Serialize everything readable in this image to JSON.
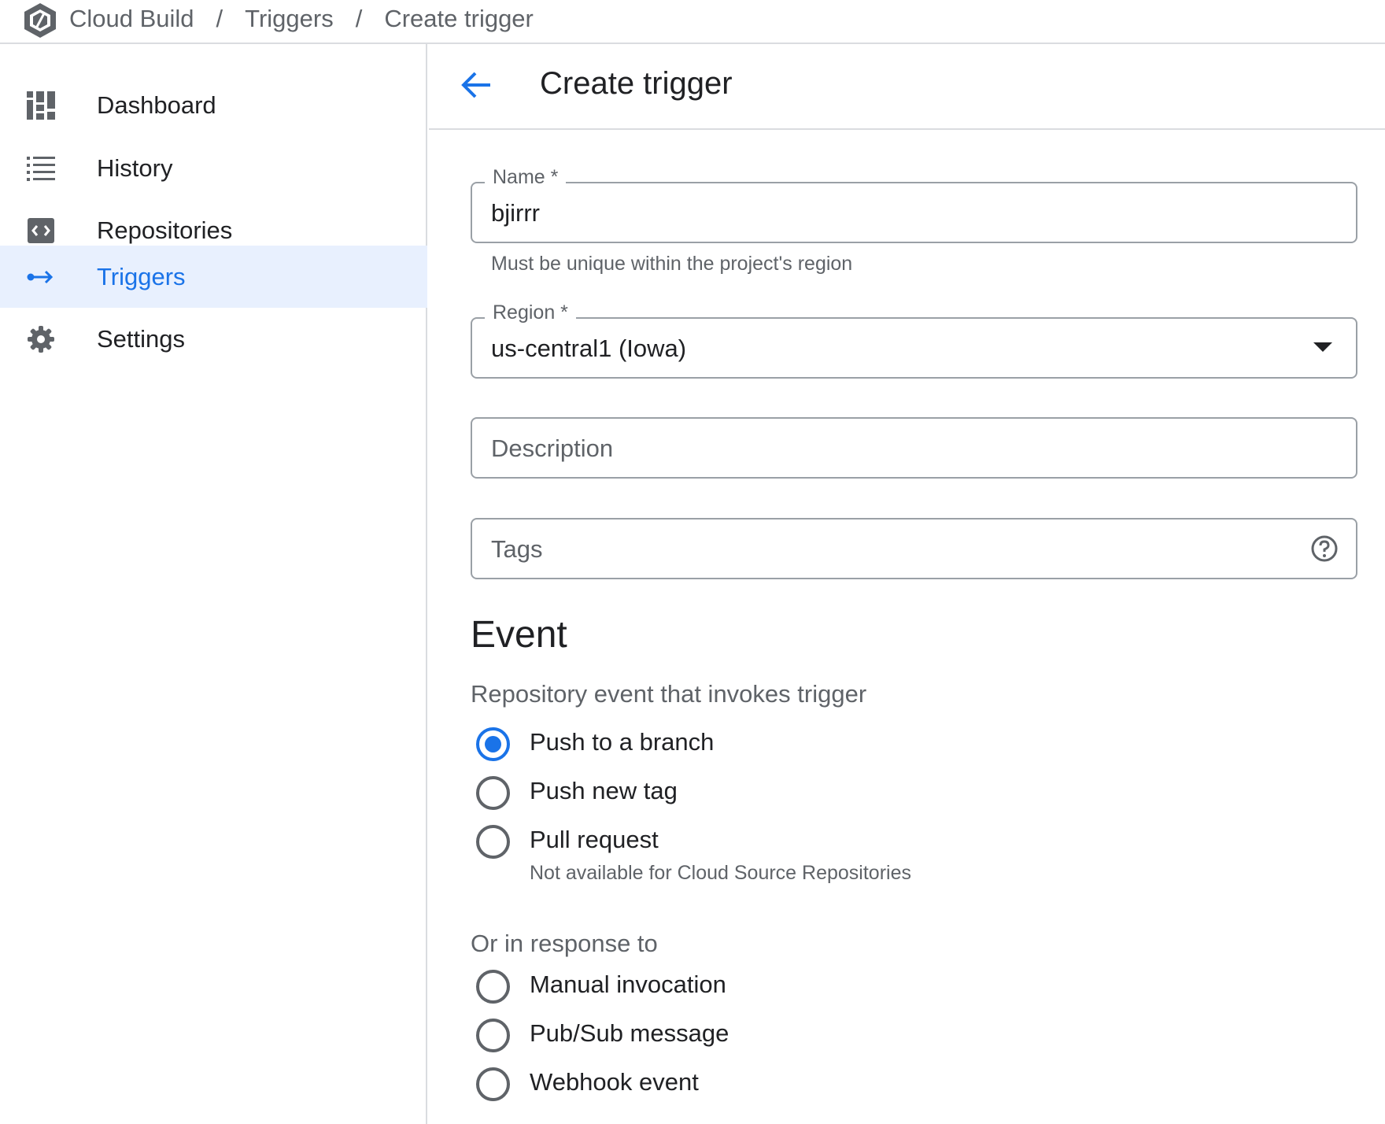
{
  "breadcrumb": {
    "items": [
      "Cloud Build",
      "Triggers",
      "Create trigger"
    ],
    "separator": "/"
  },
  "sidebar": {
    "items": [
      {
        "label": "Dashboard",
        "icon": "dashboard-icon",
        "active": false
      },
      {
        "label": "History",
        "icon": "list-icon",
        "active": false
      },
      {
        "label": "Repositories",
        "icon": "code-icon",
        "active": false
      },
      {
        "label": "Triggers",
        "icon": "trigger-arrow-icon",
        "active": true
      },
      {
        "label": "Settings",
        "icon": "gear-icon",
        "active": false
      }
    ]
  },
  "header": {
    "title": "Create trigger",
    "back_icon": "arrow-back-icon"
  },
  "form": {
    "name": {
      "label": "Name *",
      "value": "bjirrr",
      "helper": "Must be unique within the project's region"
    },
    "region": {
      "label": "Region *",
      "value": "us-central1 (Iowa)"
    },
    "description": {
      "placeholder": "Description"
    },
    "tags": {
      "placeholder": "Tags",
      "help_icon": "help-circle-icon"
    }
  },
  "event": {
    "title": "Event",
    "subtitle": "Repository event that invokes trigger",
    "options": [
      {
        "label": "Push to a branch",
        "checked": true
      },
      {
        "label": "Push new tag",
        "checked": false
      },
      {
        "label": "Pull request",
        "checked": false,
        "hint": "Not available for Cloud Source Repositories"
      }
    ],
    "response_subtitle": "Or in response to",
    "response_options": [
      {
        "label": "Manual invocation",
        "checked": false
      },
      {
        "label": "Pub/Sub message",
        "checked": false
      },
      {
        "label": "Webhook event",
        "checked": false
      }
    ]
  },
  "colors": {
    "accent": "#1a73e8",
    "active_bg": "#e8f0fe",
    "border": "#dadce0",
    "muted_text": "#5f6368"
  }
}
